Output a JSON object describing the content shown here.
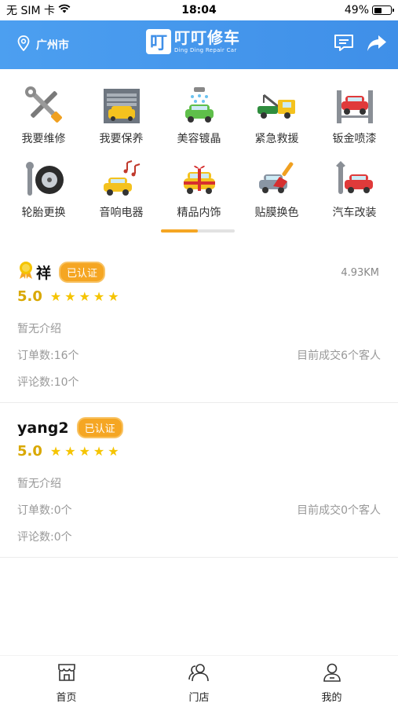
{
  "status_bar": {
    "carrier": "无 SIM 卡",
    "time": "18:04",
    "battery": "49%",
    "battery_level": 0.49
  },
  "header": {
    "location": "广州市",
    "logo_mark": "叮",
    "logo_title": "叮叮修车",
    "logo_subtitle": "Ding Ding Repair Car"
  },
  "categories": [
    {
      "label": "我要维修",
      "icon": "wrench-screwdriver-icon"
    },
    {
      "label": "我要保养",
      "icon": "garage-car-icon"
    },
    {
      "label": "美容镀晶",
      "icon": "car-wash-icon"
    },
    {
      "label": "紧急救援",
      "icon": "tow-truck-icon"
    },
    {
      "label": "钣金喷漆",
      "icon": "car-lift-icon"
    },
    {
      "label": "轮胎更换",
      "icon": "tire-wrench-icon"
    },
    {
      "label": "音响电器",
      "icon": "car-music-icon"
    },
    {
      "label": "精品内饰",
      "icon": "gift-car-icon"
    },
    {
      "label": "贴膜换色",
      "icon": "car-paint-brush-icon"
    },
    {
      "label": "汽车改装",
      "icon": "car-mod-wrench-icon"
    }
  ],
  "page_indicator": {
    "progress": 0.5
  },
  "shops": [
    {
      "name": "祥",
      "badge": "已认证",
      "distance": "4.93KM",
      "score": "5.0",
      "stars": 5,
      "intro": "暂无介绍",
      "orders": "订单数:16个",
      "deals": "目前成交6个客人",
      "reviews": "评论数:10个"
    },
    {
      "name": "yang2",
      "badge": "已认证",
      "distance": "",
      "score": "5.0",
      "stars": 5,
      "intro": "暂无介绍",
      "orders": "订单数:0个",
      "deals": "目前成交0个客人",
      "reviews": "评论数:0个"
    }
  ],
  "tabbar": [
    {
      "label": "首页",
      "icon": "home-store-icon"
    },
    {
      "label": "门店",
      "icon": "people-icon"
    },
    {
      "label": "我的",
      "icon": "user-icon"
    }
  ],
  "colors": {
    "header": "#4c9ff0",
    "accent": "#f5a623",
    "score": "#d9a800"
  }
}
